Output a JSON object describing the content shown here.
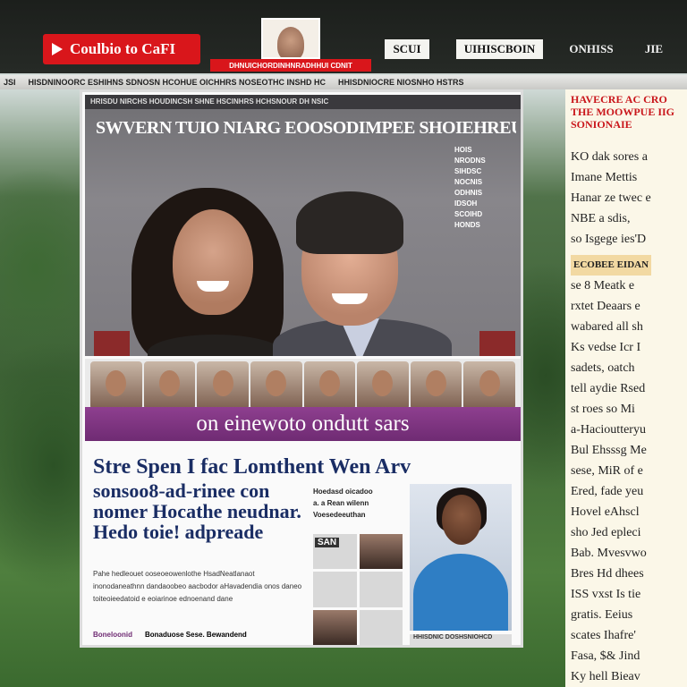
{
  "header": {
    "brand_label": "Coulbio to CaFI",
    "sub_label": "DHNUICHORDINHNRADHHUI CDNIT",
    "nav": [
      "SCUI",
      "UIHISCBOIN",
      "ONHISS",
      "JIE"
    ]
  },
  "ticker": {
    "items": [
      "JSI",
      "HISDNINOORC ESHIHNS SDNOSN HCOHUE OICHHRS NOSEOTHC INSHD HC",
      "HHISDNIOCRE NIOSNHO HSTRS"
    ]
  },
  "article": {
    "strip": "HRISDU NIRCHS HOUDINCSH SHNE HSCINHRS HCHSNOUR DH NSIC",
    "hero_title": "SWVERN TUIO NIARG EOOSODIMPEE SHOIEHREUSE",
    "hero_side": [
      "HOIS",
      "NRODNS",
      "SIHDSC",
      "NOCNIS",
      "ODHNIS",
      "IDSOH",
      "SCOIHD",
      "HONDS"
    ],
    "banner": "on einewoto ondutt sars",
    "headline": "Stre Spen I fac Lomthent Wen Arv",
    "headline_2": "sonsoo8-ad-rinee con nomer Hocathe neudnar. Hedo toie! adpreade",
    "mid_col": [
      "Hoedasd oicadoo",
      "a. a  Rean wilenn",
      "Voesedeeuthan"
    ],
    "body": "Pahe hedleouet ooseoeowenlothe HsadNeatlanaot inonodaneathnn dandaoobeo aacbodor aHavadendia onos daneo toiteoieedatoid e eoiarinoe ednoenand dane",
    "mini_label": "SAN",
    "footer_l1": "Boneloonid",
    "footer_l2": "Bonaduose Sese. Bewandend",
    "caption": "HHISDNIC DOSHSNIOHCD"
  },
  "sidebar": {
    "title_lines": [
      "HAVECRE AC CRO",
      "THE MOOWPUE IIG",
      "SONIONAIE"
    ],
    "body_lines": [
      "KO dak sores a",
      "Imane Mettis",
      "Hanar ze twec e",
      "NBE a sdis,",
      "so Isgege ies'D"
    ],
    "subhead": "ECOBEE EIDAN",
    "body_lines_2": [
      "se 8 Meatk e",
      "rxtet Deaars e",
      "wabared all sh",
      "Ks vedse Icr I",
      "sadets, oatch",
      "tell aydie Rsed",
      "st roes so Mi",
      "a-Hacioutteryu",
      "Bul Ehsssg Me",
      "sese, MiR of e",
      "Ered, fade yeu",
      "Hovel eAhscl",
      "sho Jed epleci",
      "Bab. Mvesvwo",
      "Bres Hd dhees",
      "ISS vxst Is tie",
      "gratis. Eeius",
      "scates Ihafre'",
      "Fasa, $& Jind",
      "Ky hell Bieav"
    ]
  },
  "colors": {
    "brand_red": "#d9161b",
    "banner_purple": "#7a327d",
    "headline_navy": "#1a2d64",
    "sidebar_bg": "#fbf7e8"
  }
}
